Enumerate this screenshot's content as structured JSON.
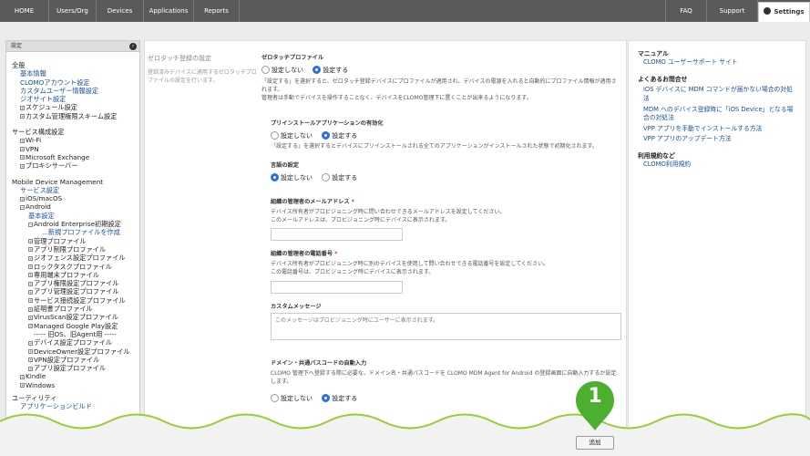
{
  "nav": {
    "items": [
      "HOME",
      "Users/Org",
      "Devices",
      "Applications",
      "Reports"
    ],
    "faq": "FAQ",
    "support": "Support",
    "settings": "Settings"
  },
  "sidebar": {
    "header": "設定",
    "general": {
      "title": "全般",
      "links": [
        "基本情報",
        "CLOMOアカウント設定",
        "カスタムユーザー情報設定",
        "ジオサイト設定"
      ],
      "tree": [
        "スケジュール設定",
        "カスタム管理権限スキーム設定"
      ]
    },
    "service": {
      "title": "サービス構成設定",
      "tree": [
        "Wi-Fi",
        "VPN",
        "Microsoft Exchange",
        "プロキシサーバー"
      ]
    },
    "mdm": {
      "title": "Mobile Device Management",
      "service_settings": "サービス設定",
      "ios": "iOS/macOS",
      "android": "Android",
      "basic": "基本設定",
      "enterprise": "Android Enterprise初期設定",
      "new_profile": "...新規プロファイルを作成",
      "profiles": [
        "管理プロファイル",
        "アプリ制限プロファイル",
        "ジオフェンス設定プロファイル",
        "ロックタスクプロファイル",
        "専用端末プロファイル",
        "アプリ権限設定プロファイル",
        "アプリ管理設定プロファイル",
        "サービス接続設定プロファイル",
        "証明書プロファイル",
        "VirusScan設定プロファイル",
        "Managed Google Play設定"
      ],
      "old_divider": "----- 旧OS、旧Agent用 -----",
      "old_profiles": [
        "デバイス設定プロファイル",
        "DeviceOwner設定プロファイル",
        "VPN設定プロファイル",
        "アプリ設定プロファイル"
      ],
      "kindle": "Kindle",
      "windows": "Windows"
    },
    "utility": {
      "title": "ユーティリティ",
      "link": "アプリケーションビルド"
    }
  },
  "main": {
    "left_title": "ゼロタッチ登録の設定",
    "left_desc": "登録済みデバイスに適用するゼロタッチプロファイルの設定を行います。",
    "zt": {
      "title": "ゼロタッチプロファイル",
      "opt_off": "設定しない",
      "opt_on": "設定する",
      "desc1": "「設定する」を選択すると、ゼロタッチ登録デバイスにプロファイルが適用され、デバイスの電源を入れると自動的にプロファイル情報が適用されます。",
      "desc2": "管理者は手動でデバイスを操作することなく、デバイスをCLOMO管理下に置くことが出来るようになります。"
    },
    "preinstall": {
      "title": "プリインストールアプリケーションの有効化",
      "opt_off": "設定しない",
      "opt_on": "設定する",
      "desc": "「設定する」を選択するとデバイスにプリインストールされる全てのアプリケーションがインストールされた状態で初期化されます。"
    },
    "lang": {
      "title": "言語の設定",
      "opt_off": "設定しない",
      "opt_on": "設定する"
    },
    "email": {
      "title": "組織の管理者のメールアドレス",
      "req": "*",
      "desc1": "デバイス所有者がプロビジョニング時に問い合わせできるメールアドレスを設定してください。",
      "desc2": "このメールアドレスは、プロビジョニング時にデバイスに表示されます。"
    },
    "phone": {
      "title": "組織の管理者の電話番号",
      "req": "*",
      "desc1": "デバイス所有者がプロビジョニング時に別のデバイスを使用して問い合わせできる電話番号を設定してください。",
      "desc2": "この電話番号は、プロビジョニング時にデバイスに表示されます。"
    },
    "custom_msg": {
      "title": "カスタムメッセージ",
      "placeholder": "このメッセージはプロビジョニング時にユーザーに表示されます。"
    },
    "domain": {
      "title": "ドメイン・共通パスコードの自動入力",
      "desc": "CLOMO 管理下へ登録する際に必要な、ドメイン名・共通パスコードを CLOMO MDM Agent for Android の登録画面に自動入力するか設定します。",
      "opt_off": "設定しない",
      "opt_on": "設定する"
    },
    "add_button": "追加"
  },
  "rightbar": {
    "manual_title": "マニュアル",
    "manual_link": "CLOMO ユーザーサポート サイト",
    "faq_title": "よくあるお問合せ",
    "faq_links": [
      "iOS デバイスに MDM コマンドが届かない場合の対処法",
      "MDM へのデバイス登録時に「iOS Device」となる場合の対処法",
      "VPP アプリを手動でインストールする方法",
      "VPP アプリのアップデート方法"
    ],
    "terms_title": "利用規約など",
    "terms_link": "CLOMO利用規約"
  },
  "marker": "1",
  "colors": {
    "accent": "#2a6fe0",
    "link": "#1a4fa0",
    "marker": "#4caf2e",
    "nav": "#5a5a5a"
  }
}
